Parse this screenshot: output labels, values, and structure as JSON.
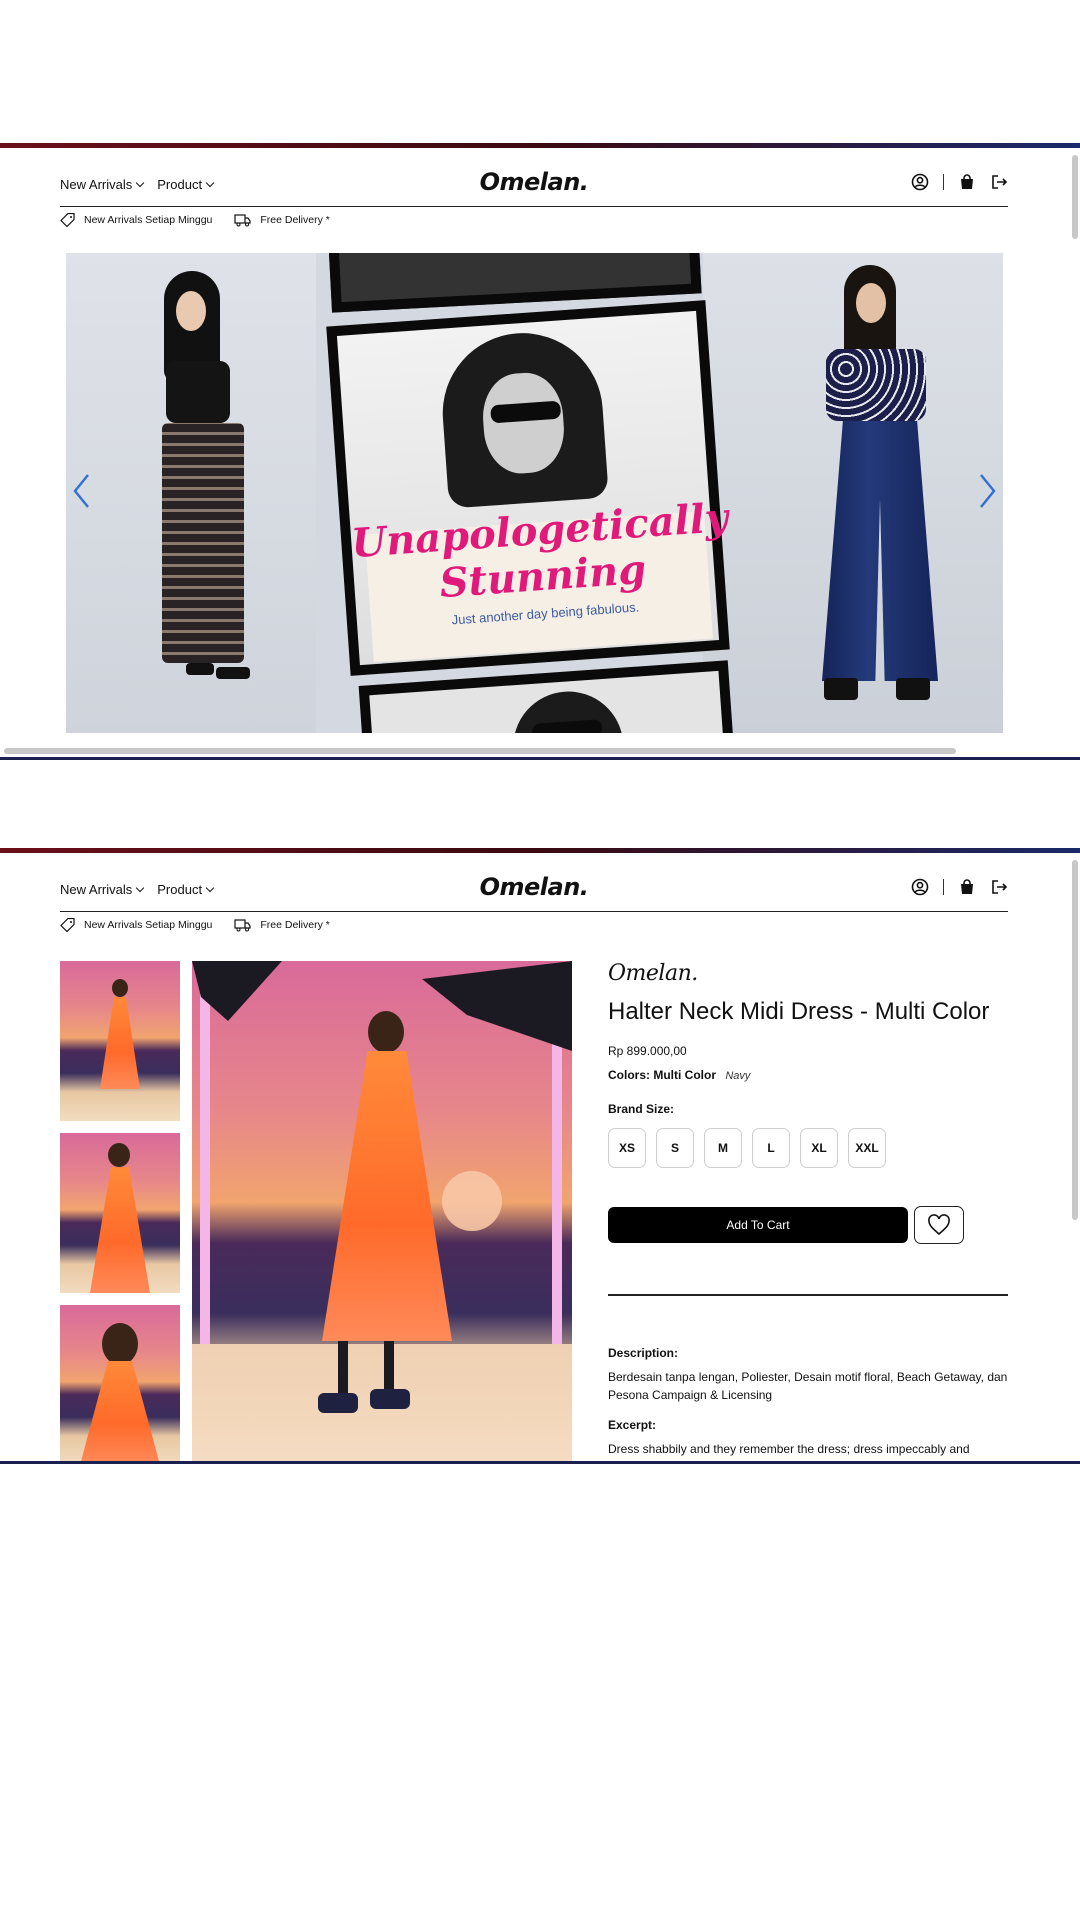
{
  "header": {
    "nav": [
      {
        "label": "New Arrivals"
      },
      {
        "label": "Product"
      }
    ],
    "logo": "Omelan.",
    "promo": {
      "weekly": "New Arrivals Setiap Minggu",
      "delivery": "Free Delivery *"
    }
  },
  "banner": {
    "headline_line1": "Unapologetically",
    "headline_line2": "Stunning",
    "tagline": "Just another day being fabulous."
  },
  "product": {
    "brand": "Omelan.",
    "title": "Halter Neck Midi Dress - Multi Color",
    "price": "Rp 899.000,00",
    "colors_label": "Colors: Multi Color",
    "colors_value": "Navy",
    "size_label": "Brand Size:",
    "sizes": [
      "XS",
      "S",
      "M",
      "L",
      "XL",
      "XXL"
    ],
    "add_to_cart": "Add To Cart",
    "description_label": "Description:",
    "description": "Berdesain tanpa lengan, Poliester, Desain motif floral, Beach Getaway, dan Pesona Campaign & Licensing",
    "excerpt_label": "Excerpt:",
    "excerpt": "Dress shabbily and they remember the dress; dress impeccably and"
  },
  "colors": {
    "accent_pink": "#e01a7a",
    "tagline_blue": "#3c5aa0",
    "arrow_blue": "#2f6fd6",
    "dress_orange": "#ff6a2a"
  },
  "icons": {
    "account": "user-circle-icon",
    "bag": "shopping-bag-icon",
    "logout": "logout-icon",
    "tag": "tag-icon",
    "truck": "truck-icon",
    "wishlist": "heart-icon"
  }
}
